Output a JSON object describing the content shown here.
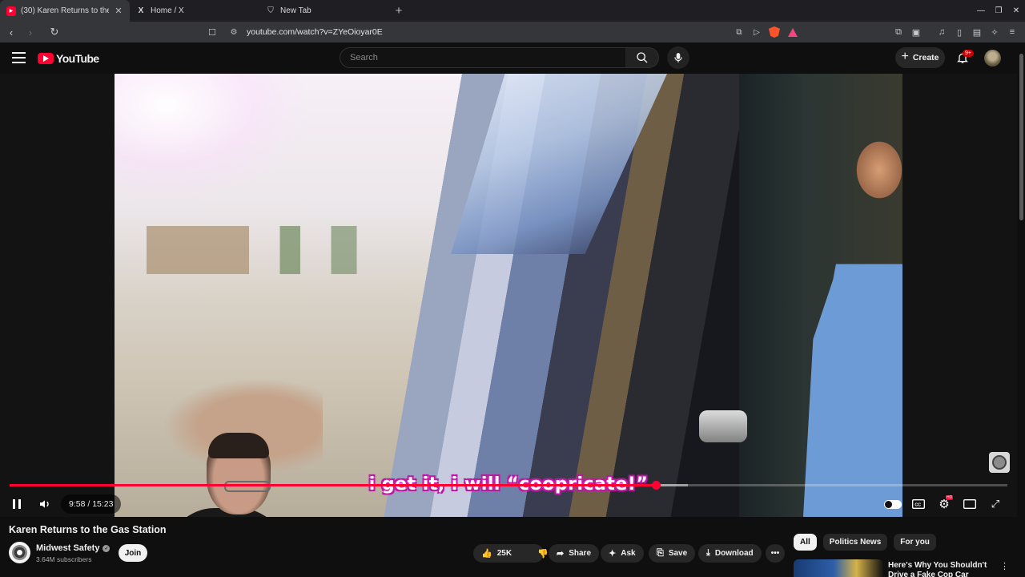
{
  "browser": {
    "tabs": [
      {
        "label": "(30) Karen Returns to the",
        "icon": "youtube-icon",
        "active": true
      },
      {
        "label": "Home / X",
        "icon": "x-logo-icon",
        "active": false
      },
      {
        "label": "New Tab",
        "icon": "brave-shield-icon",
        "active": false
      }
    ],
    "url": "youtube.com/watch?v=ZYeOioyar0E"
  },
  "youtube": {
    "logo_text": "YouTube",
    "search_placeholder": "Search",
    "create_label": "Create",
    "notification_badge": "9+"
  },
  "player": {
    "caption": "i get it, i will “coopricate!”",
    "current_time": "9:58",
    "duration": "15:23",
    "time_display": "9:58 / 15:23",
    "progress_fraction": 0.648,
    "buffered_fraction": 0.68,
    "accent_color": "#ff0033"
  },
  "video": {
    "title": "Karen Returns to the Gas Station",
    "channel_name": "Midwest Safety",
    "subscribers": "3.64M subscribers",
    "join_label": "Join",
    "likes": "25K",
    "share_label": "Share",
    "ask_label": "Ask",
    "save_label": "Save",
    "download_label": "Download"
  },
  "sidebar": {
    "chips": [
      "All",
      "Politics News",
      "For you"
    ],
    "recommendation_title": "Here's Why You Shouldn't Drive a Fake Cop Car"
  }
}
